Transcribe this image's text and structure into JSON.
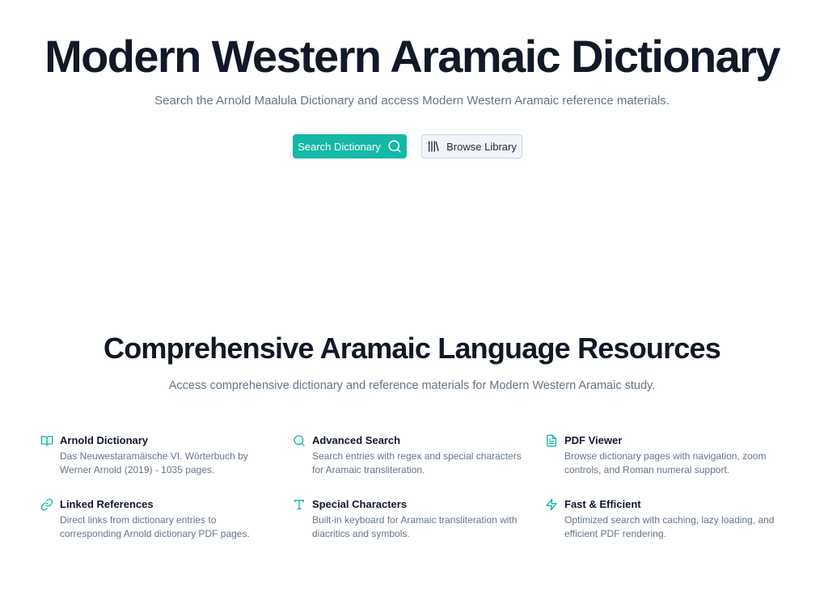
{
  "hero": {
    "title": "Modern Western Aramaic Dictionary",
    "subtitle": "Search the Arnold Maalula Dictionary and access Modern Western Aramaic reference materials.",
    "primary_button": {
      "label": "Search Dictionary",
      "icon": "search-icon"
    },
    "secondary_button": {
      "label": "Browse Library",
      "icon": "library-icon"
    }
  },
  "resources": {
    "title": "Comprehensive Aramaic Language Resources",
    "subtitle": "Access comprehensive dictionary and reference materials for Modern Western Aramaic study.",
    "features": [
      {
        "icon": "book-open-icon",
        "title": "Arnold Dictionary",
        "description": "Das Neuwestaramäische VI. Wörterbuch by Werner Arnold (2019) - 1035 pages."
      },
      {
        "icon": "search-icon",
        "title": "Advanced Search",
        "description": "Search entries with regex and special characters for Aramaic transliteration."
      },
      {
        "icon": "file-text-icon",
        "title": "PDF Viewer",
        "description": "Browse dictionary pages with navigation, zoom controls, and Roman numeral support."
      },
      {
        "icon": "link-icon",
        "title": "Linked References",
        "description": "Direct links from dictionary entries to corresponding Arnold dictionary PDF pages."
      },
      {
        "icon": "type-icon",
        "title": "Special Characters",
        "description": "Built-in keyboard for Aramaic transliteration with diacritics and symbols."
      },
      {
        "icon": "zap-icon",
        "title": "Fast & Efficient",
        "description": "Optimized search with caching, lazy loading, and efficient PDF rendering."
      }
    ]
  },
  "colors": {
    "accent": "#14b8a6",
    "heading": "#111827",
    "muted": "#64748b"
  }
}
